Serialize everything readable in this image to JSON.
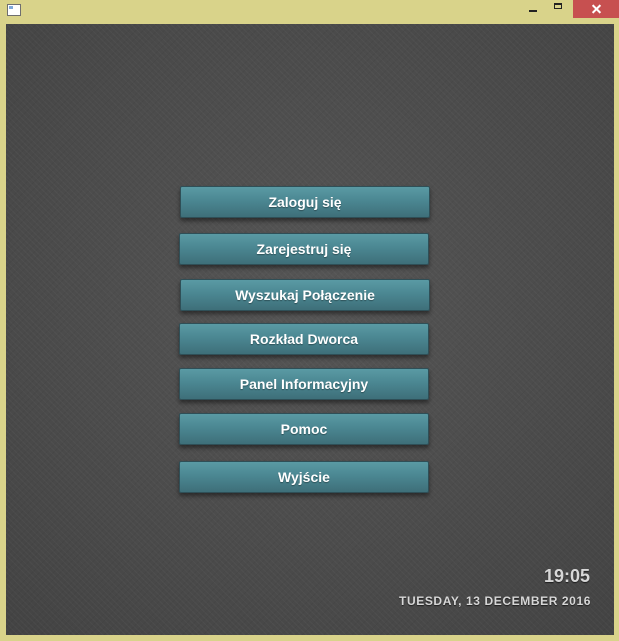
{
  "menu": {
    "buttons": [
      {
        "label": "Zaloguj się"
      },
      {
        "label": "Zarejestruj się"
      },
      {
        "label": "Wyszukaj Połączenie"
      },
      {
        "label": "Rozkład Dworca"
      },
      {
        "label": "Panel Informacyjny"
      },
      {
        "label": "Pomoc"
      },
      {
        "label": "Wyjście"
      }
    ]
  },
  "clock": {
    "time": "19:05",
    "date": "TUESDAY, 13 DECEMBER 2016"
  },
  "window": {
    "controls": [
      {
        "icon": "minimize-icon"
      },
      {
        "icon": "maximize-icon"
      },
      {
        "icon": "close-icon"
      }
    ]
  },
  "colors": {
    "titlebar": "#d9d38a",
    "close_button": "#c75050",
    "background": "#4b4b4b",
    "button": "#4b8792",
    "clock_text": "#d7d7d7"
  }
}
